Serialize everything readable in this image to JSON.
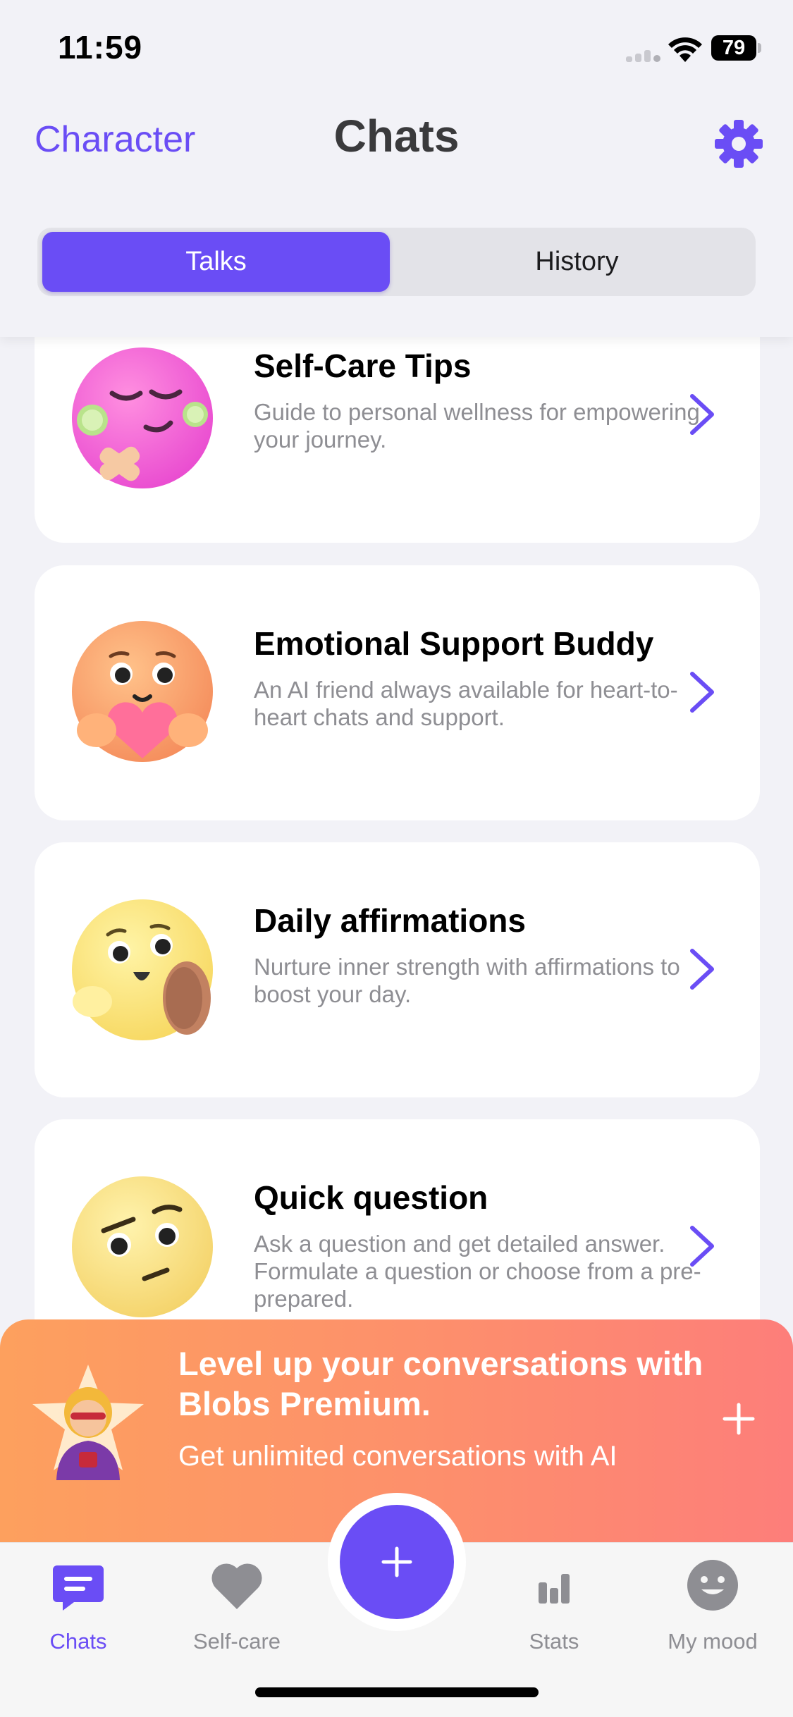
{
  "status_bar": {
    "time": "11:59",
    "battery": "79"
  },
  "header": {
    "character_label": "Character",
    "title": "Chats",
    "settings_icon": "gear-icon",
    "tabs": [
      {
        "label": "Talks",
        "selected": true
      },
      {
        "label": "History",
        "selected": false
      }
    ]
  },
  "cards": [
    {
      "title": "Self-Care Tips",
      "description": "Guide to personal wellness for empowering your journey.",
      "emoji": "cucumber-face-emoji"
    },
    {
      "title": "Emotional Support Buddy",
      "description": "An AI friend always available for heart-to-heart chats and support.",
      "emoji": "heart-hug-emoji"
    },
    {
      "title": "Daily affirmations",
      "description": "Nurture inner strength with affirmations to boost your day.",
      "emoji": "mirror-face-emoji"
    },
    {
      "title": "Quick question",
      "description": "Ask a question and get detailed answer. Formulate a question or choose from a pre-prepared.",
      "emoji": "thinking-face-emoji"
    }
  ],
  "premium": {
    "title": "Level up your conversations with Blobs Premium.",
    "subtitle": "Get unlimited conversations with AI",
    "avatar": "superhero-star-emoji"
  },
  "tabbar": {
    "items": [
      {
        "label": "Chats",
        "icon": "chat-bubble-icon",
        "active": true
      },
      {
        "label": "Self-care",
        "icon": "heart-icon",
        "active": false
      },
      {
        "label": "Stats",
        "icon": "bar-chart-icon",
        "active": false
      },
      {
        "label": "My mood",
        "icon": "smiley-icon",
        "active": false
      }
    ],
    "center_button_icon": "plus-icon"
  },
  "colors": {
    "accent": "#6a4df5",
    "background": "#f2f2f7",
    "premium_start": "#fda05e",
    "premium_end": "#fd7e7a"
  }
}
